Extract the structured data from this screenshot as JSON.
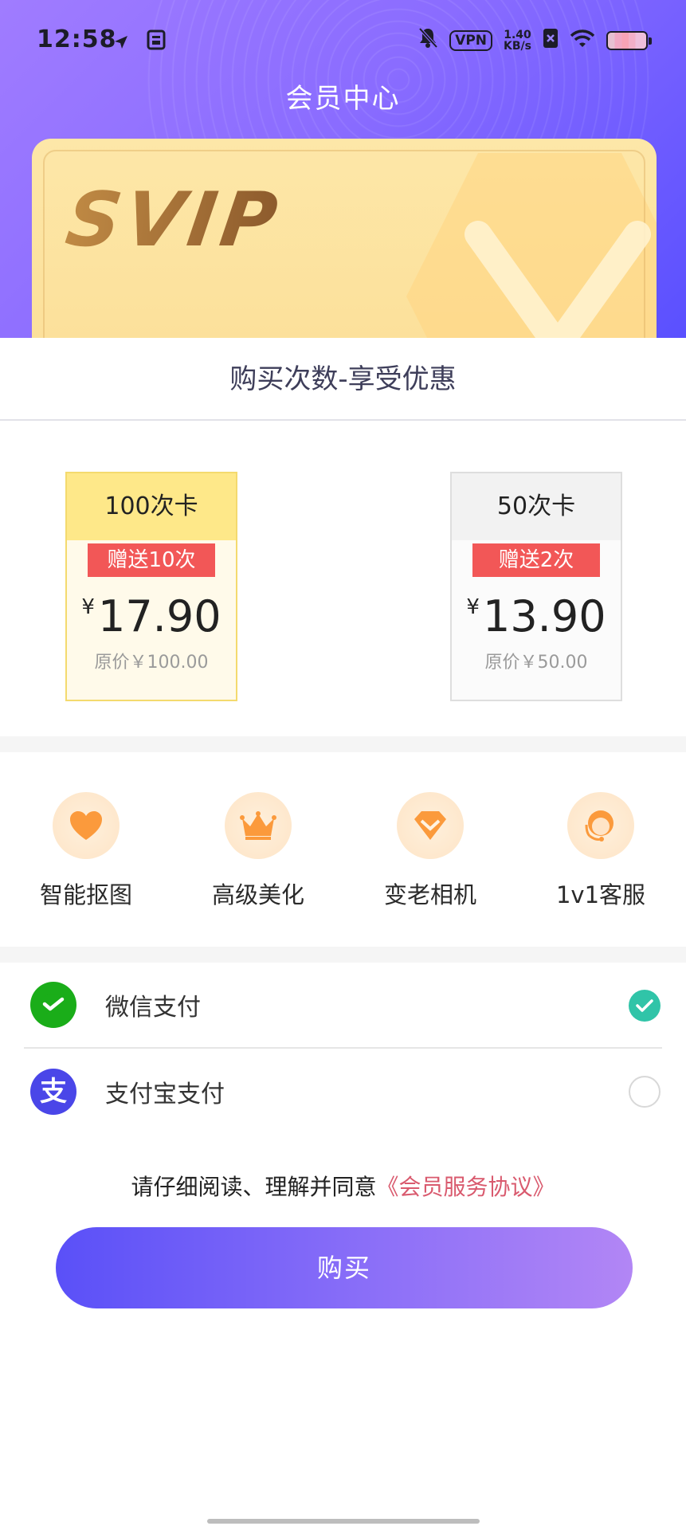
{
  "status_bar": {
    "time": "12:58",
    "vpn": "VPN",
    "net_speed_value": "1.40",
    "net_speed_unit": "KB/s"
  },
  "header": {
    "title": "会员中心",
    "card_text": "SVIP"
  },
  "section": {
    "title": "购买次数-享受优惠"
  },
  "plans": [
    {
      "name": "100次卡",
      "bonus": "赠送10次",
      "currency": "¥",
      "price": "17.90",
      "original": "原价￥100.00",
      "selected": true
    },
    {
      "name": "50次卡",
      "bonus": "赠送2次",
      "currency": "¥",
      "price": "13.90",
      "original": "原价￥50.00",
      "selected": false
    }
  ],
  "features": [
    {
      "label": "智能抠图",
      "icon": "heart-icon"
    },
    {
      "label": "高级美化",
      "icon": "crown-icon"
    },
    {
      "label": "变老相机",
      "icon": "diamond-icon"
    },
    {
      "label": "1v1客服",
      "icon": "customer-service-icon"
    }
  ],
  "payment": {
    "options": [
      {
        "label": "微信支付",
        "icon": "wechat-pay-icon",
        "selected": true
      },
      {
        "label": "支付宝支付",
        "icon": "alipay-icon",
        "selected": false
      }
    ]
  },
  "agreement": {
    "text": "请仔细阅读、理解并同意",
    "link": "《会员服务协议》"
  },
  "buy_button": {
    "label": "购买"
  },
  "colors": {
    "header_start": "#a07cff",
    "header_end": "#5a50ff",
    "bonus_red": "#f25757",
    "selected_plan_header": "#fee889",
    "check_teal": "#30c4a8",
    "link_pink": "#d95a6e",
    "button_start": "#5a50f8",
    "button_end": "#b286f5"
  }
}
